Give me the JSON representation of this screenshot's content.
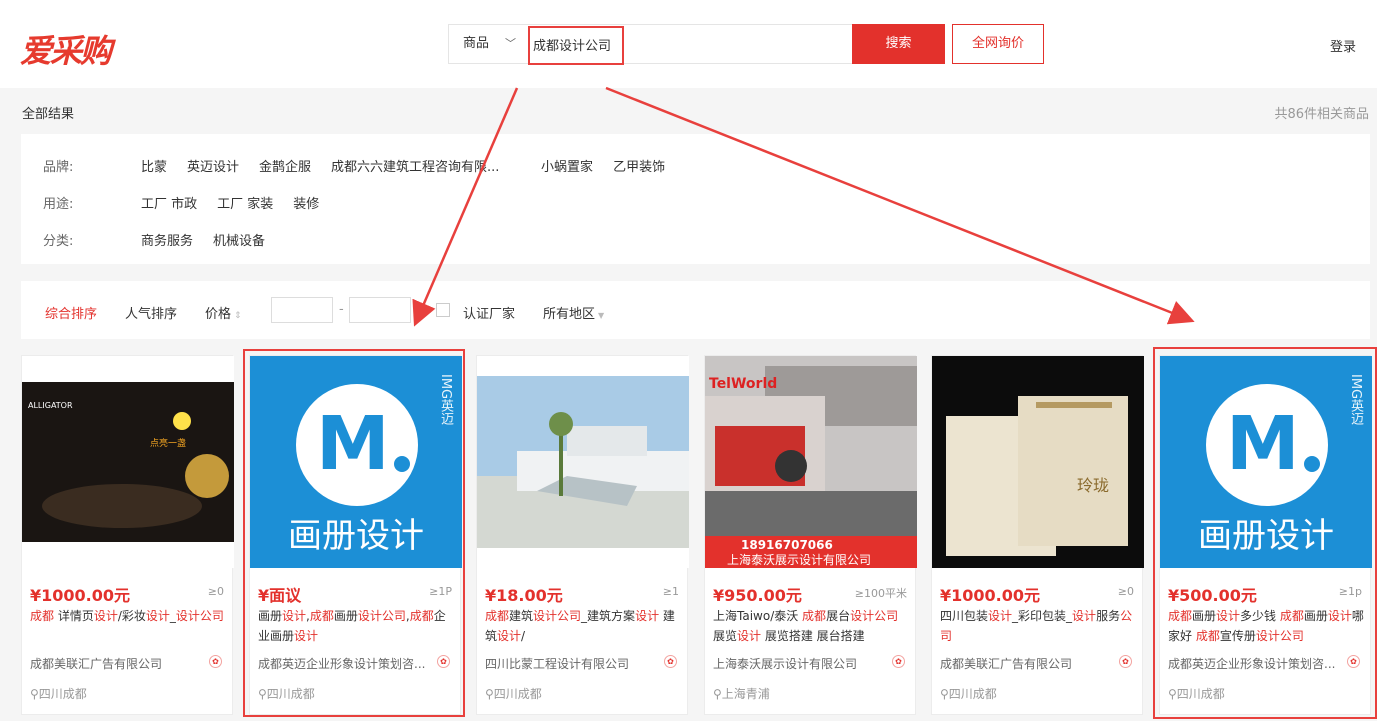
{
  "header": {
    "logo": "爱采购",
    "search_category": "商品",
    "search_value": "成都设计公司",
    "search_button": "搜索",
    "inquiry_button": "全网询价",
    "login": "登录"
  },
  "results": {
    "label": "全部结果",
    "count": "共86件相关商品"
  },
  "filters": [
    {
      "label": "品牌:",
      "options": [
        "比蒙",
        "英迈设计",
        "金鹊企服",
        "成都六六建筑工程咨询有限...",
        "小蜗置家",
        "乙甲装饰"
      ]
    },
    {
      "label": "用途:",
      "options": [
        "工厂 市政",
        "工厂 家装",
        "装修"
      ]
    },
    {
      "label": "分类:",
      "options": [
        "商务服务",
        "机械设备"
      ]
    }
  ],
  "sort": {
    "items": [
      "综合排序",
      "人气排序",
      "价格"
    ],
    "active_index": 0,
    "price_separator": "-",
    "certified_label": "认证厂家",
    "region_label": "所有地区"
  },
  "products": [
    {
      "price": "¥1000.00元",
      "moq": "≥0",
      "title_html": "<em class='red'>成都</em> 详情页<em class='red'>设计</em>/彩妆<em class='red'>设计</em>_<em class='red'>设计公司</em>",
      "company": "成都美联汇广告有限公司",
      "location": "四川成都"
    },
    {
      "price": "¥面议",
      "moq": "≥1P",
      "title_html": "画册<em class='red'>设计</em>,<em class='red'>成都</em>画册<em class='red'>设计公司</em>,<em class='red'>成都</em>企业画册<em class='red'>设计</em>",
      "company": "成都英迈企业形象设计策划咨...",
      "location": "四川成都"
    },
    {
      "price": "¥18.00元",
      "moq": "≥1",
      "title_html": "<em class='red'>成都</em>建筑<em class='red'>设计公司</em>_建筑方案<em class='red'>设计</em> 建筑<em class='red'>设计</em>/",
      "company": "四川比蒙工程设计有限公司",
      "location": "四川成都"
    },
    {
      "price": "¥950.00元",
      "moq": "≥100平米",
      "title_html": "上海Taiwo/泰沃 <em class='red'>成都</em>展台<em class='red'>设计公司</em> 展览<em class='red'>设计</em> 展览搭建 展台搭建",
      "company": "上海泰沃展示设计有限公司",
      "location": "上海青浦"
    },
    {
      "price": "¥1000.00元",
      "moq": "≥0",
      "title_html": "四川包装<em class='red'>设计</em>_彩印包装_<em class='red'>设计</em>服务<em class='red'>公司</em>",
      "company": "成都美联汇广告有限公司",
      "location": "四川成都"
    },
    {
      "price": "¥500.00元",
      "moq": "≥1p",
      "title_html": "<em class='red'>成都</em>画册<em class='red'>设计</em>多少钱 <em class='red'>成都</em>画册<em class='red'>设计</em>哪家好 <em class='red'>成都</em>宣传册<em class='red'>设计公司</em>",
      "company": "成都英迈企业形象设计策划咨...",
      "location": "四川成都"
    }
  ],
  "thumb_texts": {
    "alligator": "ALLIGATOR",
    "spotlight": "点亮一盏",
    "m_letter": "M",
    "m_side": "IMG英迈",
    "m_caption": "画册设计",
    "telworld": "TelWorld",
    "phone": "18916707066",
    "expo_company": "上海泰沃展示设计有限公司",
    "box_text": "玲珑"
  },
  "colors": {
    "accent": "#e3312c",
    "annotation": "#e8403d",
    "brand_blue": "#1c8fd6"
  }
}
